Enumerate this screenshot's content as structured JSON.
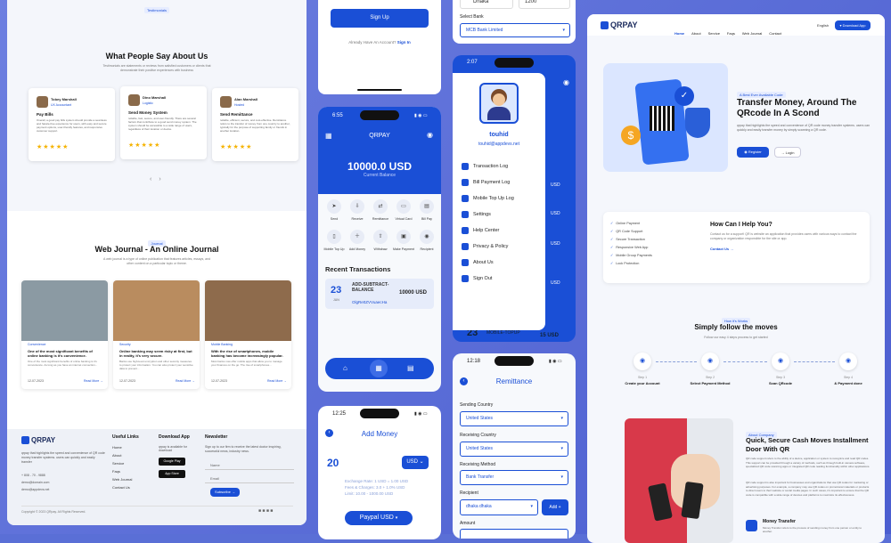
{
  "left": {
    "testimonials": {
      "badge": "Testimonials",
      "title": "What People Say About Us",
      "subtitle": "Testimonials are statements or reviews from satisfied customers or clients that demonstrate their positive experiences with business",
      "cards": [
        {
          "name": "Tobey Marshall",
          "role": "UX Accountant",
          "title": "Pay Bills",
          "text": "Overall, a good pay bills system should provide a seamless and hassle-free experience for users, with easy and secure payment options, user-friendly features, and responsive customer support.",
          "rating": 5
        },
        {
          "name": "Dino Marshall",
          "role": "Logistic",
          "title": "Send Money System",
          "text": "reliable, fast, secure, and user-friendly. There are several factors that contribute to a good send money system. The system should be accessible to a wide range of users, regardless of their location or device.",
          "rating": 5
        },
        {
          "name": "Alan Marshall",
          "role": "Hosted",
          "title": "Send Remittance",
          "text": "reliable, efficient, secure, and cost-effective. Remittance refers to the transfer of money from one country to another, typically for the purpose of supporting family or friends in another location.",
          "rating": 5
        }
      ],
      "prev": "‹",
      "next": "›"
    },
    "journal": {
      "badge": "Journal",
      "title": "Web Journal - An Online Journal",
      "subtitle": "A web journal is a type of online publication that features articles, essays, and other content on a particular topic or theme.",
      "posts": [
        {
          "category": "Convenience",
          "title": "One of the most significant benefits of online banking is it's convenience.",
          "text": "One of the most significant benefits of online banking is it's convenience. As long as you have an internet connection...",
          "date": "12-07-2023",
          "read": "Read More →"
        },
        {
          "category": "Security",
          "title": "Online banking may seem risky at first, but in reality, it's very secure.",
          "text": "Banks use high-level encryption and other security measures to protect your information. You can also protect your sensitive data to prevent...",
          "date": "12-07-2023",
          "read": "Read More →"
        },
        {
          "category": "Mobile Banking",
          "title": "With the rise of smartphones, mobile banking has become increasingly popular.",
          "text": "Most banks now offer mobile apps that allow you to manage your finances on the go. The rise of smartphones...",
          "date": "12-07-2023",
          "read": "Read More →"
        }
      ]
    },
    "footer": {
      "brand": "QRPAY",
      "about": "qrpay that highlights the speed and convenience of QR code money transfer systems. users can quickly and easily transfer",
      "contacts": [
        "+ 808 - 70 - 9888",
        "demo@domain.com",
        "demo@appdevs.net"
      ],
      "useful_title": "Useful Links",
      "useful_links": [
        "Home",
        "About",
        "Service",
        "Faqs",
        "Web Journal",
        "Contact Us"
      ],
      "download_title": "Download App",
      "download_text": "qrpay is available for download",
      "google_play": "Google Play",
      "app_store": "App Store",
      "newsletter_title": "Newsletter",
      "newsletter_text": "Sign up to our firm to receive the latest doctor inspiring, successful news, industry news.",
      "name_placeholder": "Name",
      "email_placeholder": "Email",
      "subscribe": "Subscribe →",
      "copyright": "Copyright © 2023 QRpay. All Rights Reserved."
    }
  },
  "mid1": {
    "signup": {
      "button": "Sign Up",
      "already": "Already Have An Account?",
      "signin": "Sign In"
    },
    "home": {
      "time": "6:55",
      "title": "QRPAY",
      "balance": "10000.0 USD",
      "balance_label": "Current Balance",
      "actions": [
        "Send",
        "Receive",
        "Remittance",
        "Virtual Card",
        "Bill Pay",
        "Mobile Top Up",
        "Add Money",
        "Withdraw",
        "Make Payment",
        "Recipient"
      ],
      "recent_title": "Recent Transactions",
      "tx_day": "23",
      "tx_month": "JUN",
      "tx_title": "ADD-SUBTRACT-BALANCE",
      "tx_id": "OlgRe0ZVVuaecHa",
      "tx_amount": "10000 USD"
    },
    "addmoney": {
      "time": "12:25",
      "title": "Add Money",
      "amount": "20",
      "currency": "USD",
      "rate": "Exchange Rate: 1 USD = 1.00 USD",
      "fees": "Fees & Charges: 3.0 + 1.0% USD",
      "limit": "Limit: 10.00 - 1000.00 USD",
      "method": "Paypal USD"
    }
  },
  "mid2": {
    "top": {
      "city": "Dhaka",
      "zip": "1200",
      "bank_label": "Select Bank",
      "bank": "MCB Bank Limited"
    },
    "drawer": {
      "time": "2:07",
      "name": "touhid",
      "email": "touhid@appdevs.net",
      "items": [
        "Transaction Log",
        "Bill Payment Log",
        "Mobile Top Up Log",
        "Settings",
        "Help Center",
        "Privacy & Policy",
        "About Us",
        "Sign Out"
      ],
      "side_amounts": [
        "USD",
        "USD",
        "USD",
        "USD"
      ],
      "bottom_day": "23",
      "bottom_label": "MOBILE-TOPUP",
      "bottom_amount": "15 USD"
    },
    "remittance": {
      "time": "12:18",
      "title": "Remittance",
      "sending_label": "Sending Country",
      "sending": "United States",
      "receiving_label": "Receiving Country",
      "receiving": "United States",
      "method_label": "Receiving Method",
      "method": "Bank Transfer",
      "recipient_label": "Recipient",
      "recipient": "dhaka dhaka",
      "add": "Add +",
      "amount_label": "Amount"
    }
  },
  "right": {
    "brand": "QRPAY",
    "nav": [
      "Home",
      "About",
      "Service",
      "Faqs",
      "Web Journal",
      "Contact"
    ],
    "lang": "English",
    "download": "Download App",
    "hero": {
      "badge": "A Best Ever Available Code",
      "title": "Transfer Money, Around The QRcode In A Scond",
      "text": "qrpay that highlights the speed and convenience of QR code money transfer systems. users can quickly and easily transfer money by simply scanning a QR code.",
      "register": "Register",
      "login": "Login"
    },
    "help": {
      "features": [
        "Online Payment",
        "QR Code Support",
        "Secure Transaction",
        "Responsive Web App",
        "Mobile Group Payments",
        "Lock Protection"
      ],
      "title": "How Can I Help You?",
      "text": "Contact us for a support! QR is website an application that provides users with various ways to contact the company or organization responsible for the site or app.",
      "contact": "Contact Us →"
    },
    "steps": {
      "badge": "How it's Works",
      "title": "Simply follow the moves",
      "subtitle": "Follow our easy 4 steps process to get started",
      "items": [
        {
          "num": "Step 1",
          "label": "Create your Account"
        },
        {
          "num": "Step 2",
          "label": "Select Payment Method"
        },
        {
          "num": "Step 3",
          "label": "Scan QRcode"
        },
        {
          "num": "Step 4",
          "label": "& Payment done"
        }
      ]
    },
    "about": {
      "badge": "About Company",
      "title": "Quick, Secure Cash Moves Installment Door With QR",
      "text1": "QR code support refers to the ability of a device, application or system to recognize and read QR codes. This support can be provided through a variety of methods, such as through built-in camera software, specialized QR code scanning apps or integrated QR code reading functionality within other applications.",
      "text2": "QR code support is also important for businesses and organizations that use QR codes for marketing or advertising purposes. For example, a company may use QR codes on promotional materials or products to direct users to their website or social media pages. In such cases, it's important to ensure that the QR code is compatible with a wide range of devices and platforms to maximize its effectiveness.",
      "feature_title": "Money Transfer",
      "feature_text": "Money Transfer refers to the process of sending money from one person or entity to another."
    }
  }
}
